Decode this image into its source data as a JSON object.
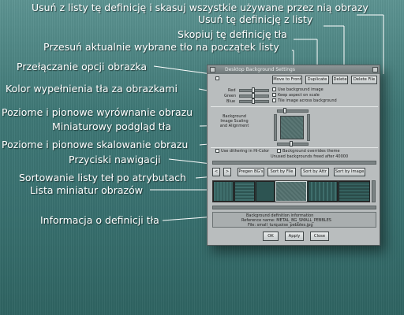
{
  "annotations": {
    "delete_all": "Usuń z listy tę definicję i skasuj wszystkie używane przez nią obrazy",
    "delete_def": "Usuń tę definicję z listy",
    "copy_def": "Skopiuj tę definicję tła",
    "move_front": "Przesuń aktualnie wybrane tło na początek listy",
    "toggle_image": "Przełączanie opcji obrazka",
    "fill_color": "Kolor wypełnienia tła za obrazkami",
    "align": "Poziome i pionowe wyrównanie obrazu",
    "preview": "Miniaturowy podgląd tła",
    "scale": "Poziome i pionowe skalowanie obrazu",
    "nav": "Przyciski nawigacji",
    "sort": "Sortowanie listy teł po atrybutach",
    "thumbs": "Lista miniatur obrazów",
    "info": "Informacja o definicji tła"
  },
  "window": {
    "title": "Desktop Background Settings",
    "buttons": {
      "move": "Move to Front",
      "dup": "Duplicate",
      "del": "Delete",
      "del_file": "Delete File"
    },
    "color_labels": {
      "red": "Red",
      "green": "Green",
      "blue": "Blue"
    },
    "checks": {
      "use_bg": "Use background image",
      "keep_aspect": "Keep aspect on scale",
      "tile": "Tile image across background",
      "dither": "Use dithering in Hi-Color",
      "override": "Background overrides theme"
    },
    "preview_label": "Background Image Scaling and Alignment",
    "unused_text": "Unused backgrounds freed after 40000",
    "nav": {
      "prev": "<",
      "next": ">",
      "pregen": "Pregen BG's",
      "by_name": "Sort by File",
      "by_attr": "Sort by Attr",
      "by_image": "Sort by Image"
    },
    "info": {
      "heading": "Background definition information",
      "id_line": "Reference name: METAL_BG_SMALL_PEBBLES",
      "file_line": "File: small_turquoise_pebbles.jpg"
    },
    "footer": {
      "ok": "OK",
      "apply": "Apply",
      "close": "Close"
    }
  },
  "colors": {
    "bg_top": "#5d9492",
    "bg_bottom": "#2f6462",
    "window_body": "#b9bdbe",
    "thumb_a": "#3f6e6c",
    "thumb_b": "#2d5452"
  }
}
